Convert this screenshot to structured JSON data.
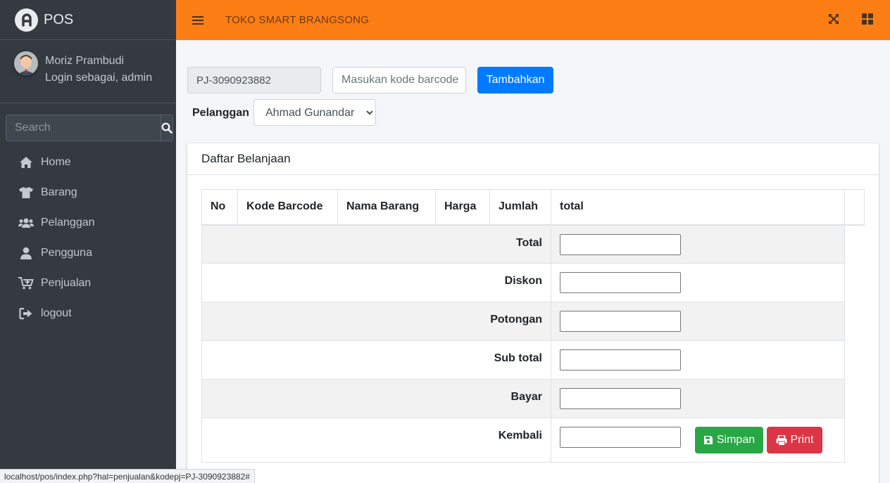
{
  "app": {
    "brand": "POS",
    "store_title": "TOKO SMART BRANGSONG"
  },
  "user": {
    "name": "Moriz Prambudi",
    "role": "Login sebagai, admin"
  },
  "sidebar": {
    "search_placeholder": "Search",
    "items": [
      {
        "label": "Home",
        "icon": "home-icon"
      },
      {
        "label": "Barang",
        "icon": "tshirt-icon"
      },
      {
        "label": "Pelanggan",
        "icon": "users-icon"
      },
      {
        "label": "Pengguna",
        "icon": "user-icon"
      },
      {
        "label": "Penjualan",
        "icon": "cart-plus-icon"
      },
      {
        "label": "logout",
        "icon": "sign-out-icon"
      }
    ]
  },
  "form": {
    "kode_value": "PJ-3090923882",
    "barcode_placeholder": "Masukan kode barcode",
    "tambah_label": "Tambahkan",
    "pelanggan_label": "Pelanggan",
    "pelanggan_selected": "Ahmad Gunandar"
  },
  "card": {
    "title": "Daftar Belanjaan",
    "columns": [
      "No",
      "Kode Barcode",
      "Nama Barang",
      "Harga",
      "Jumlah",
      "total"
    ],
    "summary_rows": [
      "Total",
      "Diskon",
      "Potongan",
      "Sub total",
      "Bayar",
      "Kembali"
    ],
    "simpan_label": "Simpan",
    "print_label": "Print"
  },
  "colors": {
    "navbar": "#fd7e14",
    "sidebar": "#343a40",
    "primary": "#007bff",
    "success": "#28a745",
    "danger": "#dc3545"
  },
  "statusbar": {
    "url": "localhost/pos/index.php?hal=penjualan&kodepj=PJ-3090923882#"
  }
}
